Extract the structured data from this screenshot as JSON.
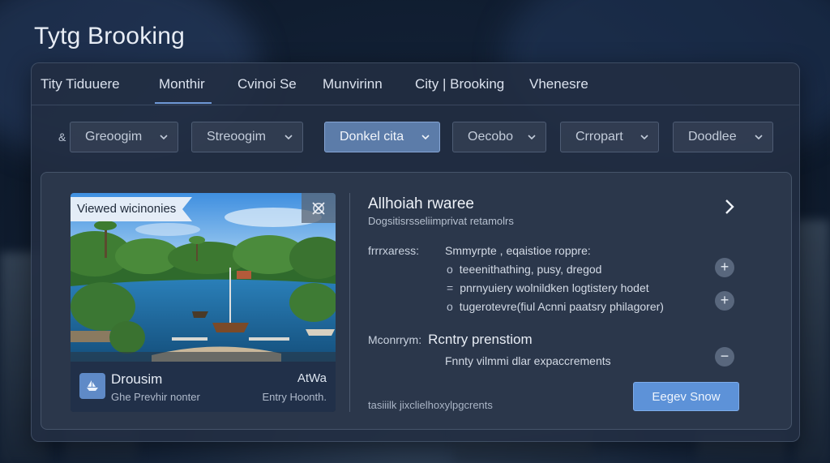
{
  "app": {
    "title": "Tytg Brooking"
  },
  "tabs": [
    {
      "label": "Tity Tiduuere"
    },
    {
      "label": "Monthir"
    },
    {
      "label": "Cvinoi Se"
    },
    {
      "label": "Munvirinn"
    },
    {
      "label": "City | Brooking"
    },
    {
      "label": "Vhenesre"
    }
  ],
  "active_tab": "Monthir",
  "filters": {
    "prefix": "&",
    "dropdowns": [
      {
        "label": "Greoogim"
      },
      {
        "label": "Streoogim"
      },
      {
        "label": "Donkel cita"
      },
      {
        "label": "Oecobo"
      },
      {
        "label": "Crropart"
      },
      {
        "label": "Doodlee"
      }
    ],
    "selected": "Donkel cita"
  },
  "listing": {
    "photo_badge": "Viewed wicinonies",
    "photo_icon": "close-crossed-icon",
    "name": "Drousim",
    "subtitle": "Ghe Prevhir nonter",
    "right_top": "AtWa",
    "right_bottom": "Entry Hoonth.",
    "footer_icon": "boat-icon"
  },
  "details": {
    "title": "Allhoiah rwaree",
    "subtitle": "Dogsitisrsseliimprivat retamolrs",
    "features_label": "frrrxaress:",
    "features": [
      "Smmyrpte , eqaistioe roppre:",
      "teeenithathing, pusy, dregod",
      "pnrnyuiery wolnildken logtistery hodet",
      "tugerotevre(fiul Acnni paatsry philagorer)"
    ],
    "feature_bullets": [
      "",
      "o",
      "=",
      "o"
    ],
    "section_label": "Mconrrym:",
    "section_title": "Rcntry prenstiom",
    "section_text": "Fnnty vilmmi dlar expaccrements",
    "footer_note": "tasiiilk jixclielhoxylpgcrents",
    "primary_button": "Eegev Snow",
    "plus_symbol": "+",
    "minus_symbol": "−"
  },
  "colors": {
    "accent": "#5d92d8",
    "active_dropdown": "#5c7ca9",
    "panel": "#222e42",
    "tab_underline": "#6f98d6"
  }
}
